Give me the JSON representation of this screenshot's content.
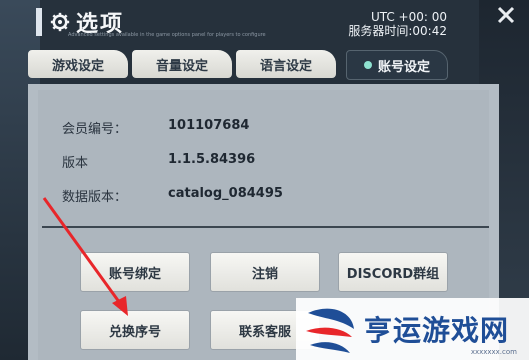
{
  "header": {
    "title": "选项",
    "subtitle": "Advanced settings available in the game options panel for players to configure"
  },
  "clock": {
    "utc": "UTC +00: 00",
    "server_time": "服务器时间:00:42"
  },
  "tabs": [
    {
      "label": "游戏设定"
    },
    {
      "label": "音量设定"
    },
    {
      "label": "语言设定"
    },
    {
      "label": "账号设定"
    }
  ],
  "account": {
    "member_id_label": "会员编号：",
    "member_id_value": "101107684",
    "version_label": "版本",
    "version_value": "1.1.5.84396",
    "data_version_label": "数据版本：",
    "data_version_value": "catalog_084495"
  },
  "buttons": {
    "bind_account": "账号绑定",
    "logout": "注销",
    "discord": "DISCORD群组",
    "redeem_code": "兑换序号",
    "contact_support": "联系客服"
  },
  "watermark": {
    "text": "亨运游戏网",
    "sub": "xxxxxxx.com"
  },
  "colors": {
    "panel": "#b3bcc4",
    "active_tab": "#2a3744",
    "arrow": "#e8262a"
  }
}
